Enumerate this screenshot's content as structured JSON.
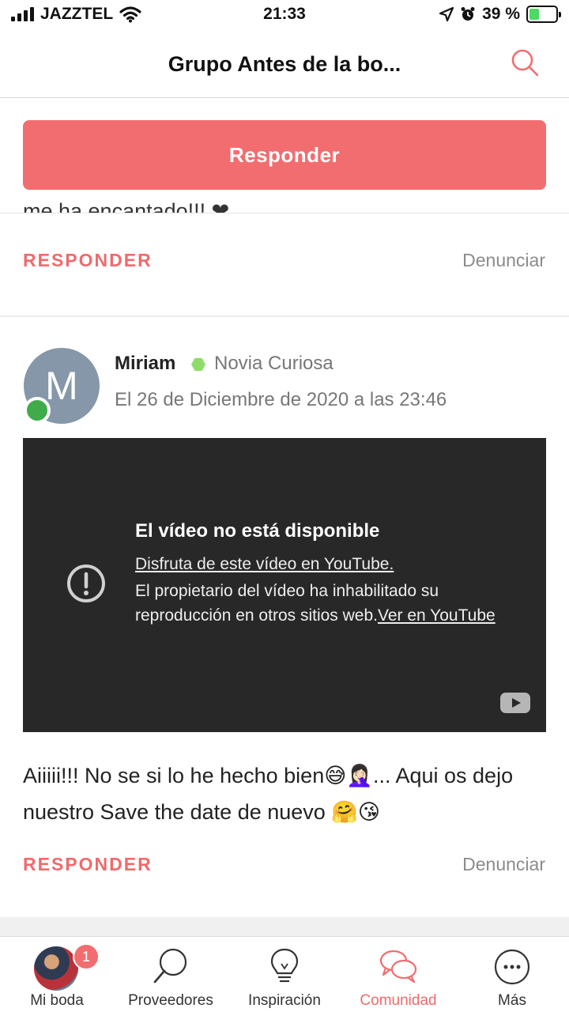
{
  "status_bar": {
    "carrier": "JAZZTEL",
    "time": "21:33",
    "battery_percent": "39 %",
    "battery_level": 0.39,
    "battery_color": "#4cd964"
  },
  "header": {
    "title": "Grupo Antes de la bo...",
    "search_icon": "search-icon",
    "accent": "#f26d6f"
  },
  "reply_button": {
    "label": "Responder"
  },
  "previous_post": {
    "truncated_text": "me ha encantado!!! ❤",
    "reply_label": "RESPONDER",
    "report_label": "Denunciar"
  },
  "post": {
    "avatar_initial": "M",
    "author": "Miriam",
    "role": "Novia Curiosa",
    "date": "El 26 de Diciembre de 2020 a las 23:46",
    "video": {
      "title": "El vídeo no está disponible",
      "link": "Disfruta de este vídeo en YouTube.",
      "message": "El propietario del vídeo ha inhabilitado su reproducción en otros sitios web.",
      "message_link": "Ver en YouTube"
    },
    "text": "Aiiiii!!! No se si lo he hecho bien😅🤦🏻‍♀️... Aqui os dejo nuestro Save the date de nuevo 🤗😘",
    "reply_label": "RESPONDER",
    "report_label": "Denunciar"
  },
  "tabbar": {
    "items": [
      {
        "label": "Mi boda",
        "icon": "avatar-photo",
        "badge": "1"
      },
      {
        "label": "Proveedores",
        "icon": "magnifier-icon"
      },
      {
        "label": "Inspiración",
        "icon": "lightbulb-icon"
      },
      {
        "label": "Comunidad",
        "icon": "chat-bubbles-icon",
        "active": true
      },
      {
        "label": "Más",
        "icon": "more-icon"
      }
    ]
  }
}
